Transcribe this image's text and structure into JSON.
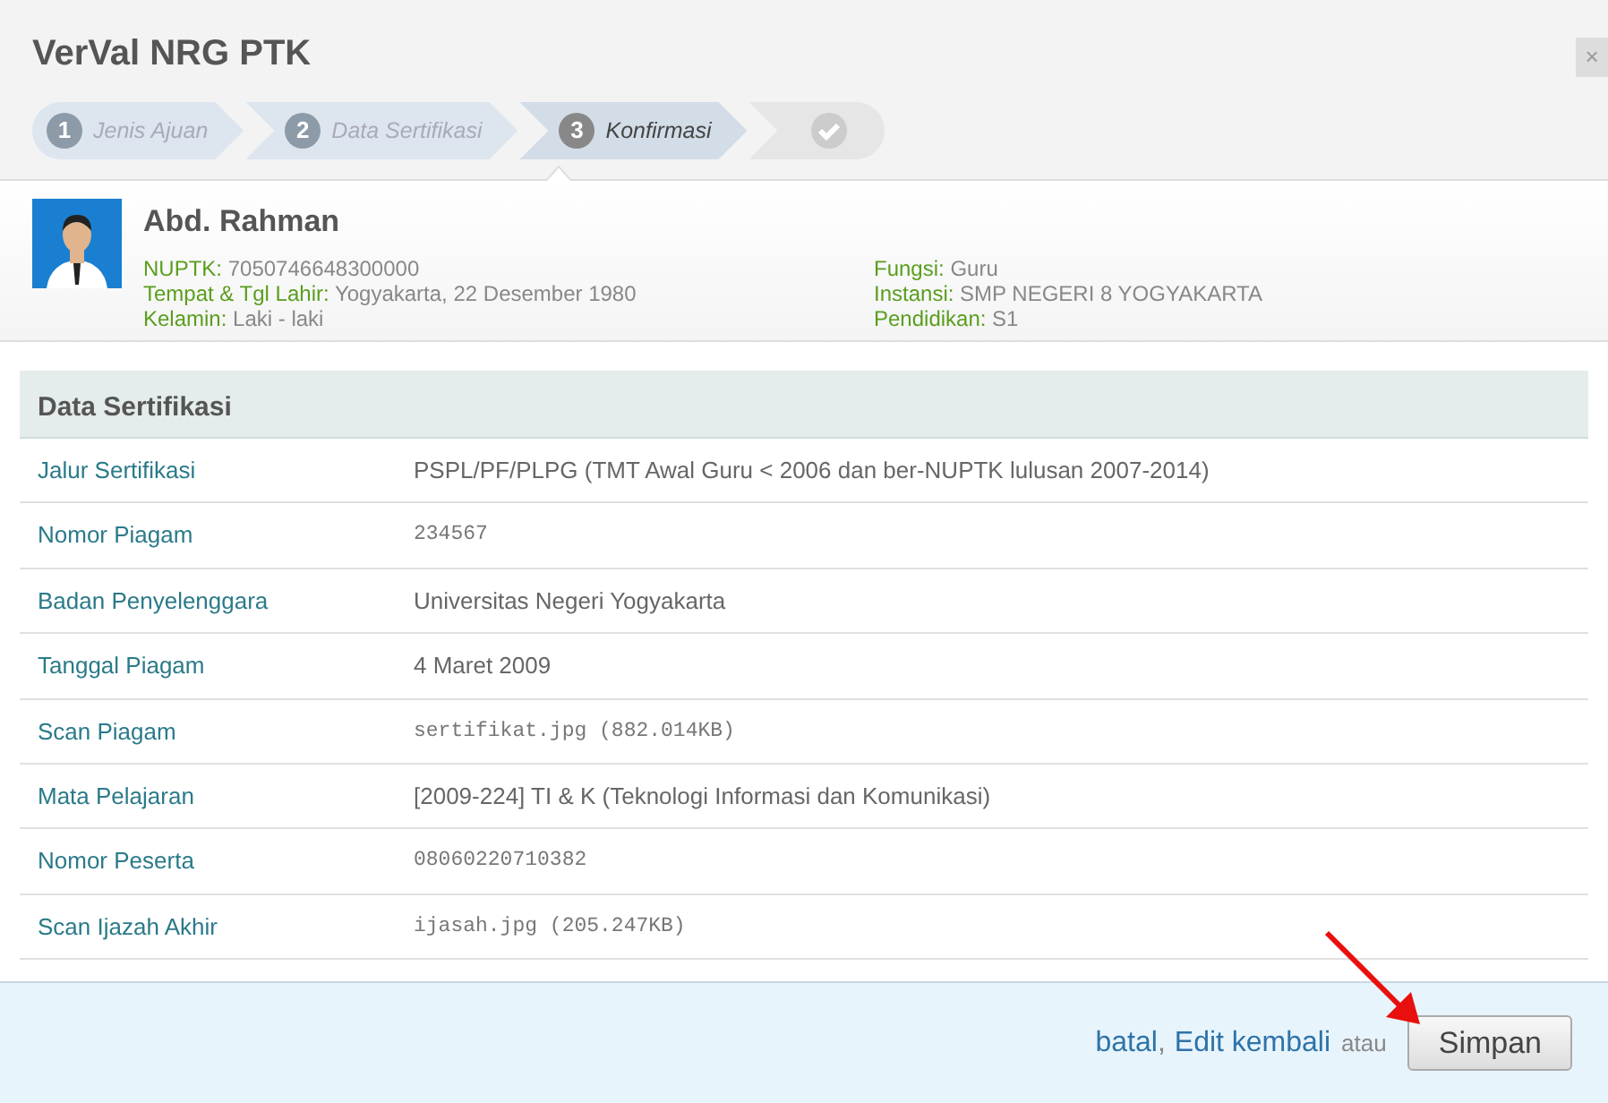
{
  "window": {
    "title": "VerVal NRG PTK",
    "close": "×"
  },
  "steps": [
    {
      "kind": "numbered",
      "number": "1",
      "label": "Jenis Ajuan",
      "selected": false
    },
    {
      "kind": "numbered",
      "number": "2",
      "label": "Data Sertifikasi",
      "selected": false
    },
    {
      "kind": "numbered",
      "number": "3",
      "label": "Konfirmasi",
      "selected": true
    },
    {
      "kind": "final",
      "selected": false
    }
  ],
  "profile": {
    "name": "Abd. Rahman",
    "left": [
      {
        "label": "NUPTK:",
        "value": "7050746648300000"
      },
      {
        "label": "Tempat & Tgl Lahir:",
        "value": "Yogyakarta, 22 Desember 1980"
      },
      {
        "label": "Kelamin:",
        "value": "Laki - laki"
      }
    ],
    "right": [
      {
        "label": "Fungsi:",
        "value": "Guru"
      },
      {
        "label": "Instansi:",
        "value": "SMP NEGERI 8 YOGYAKARTA"
      },
      {
        "label": "Pendidikan:",
        "value": "S1"
      }
    ]
  },
  "table": {
    "title": "Data Sertifikasi",
    "rows": [
      {
        "label": "Jalur Sertifikasi",
        "value": "PSPL/PF/PLPG (TMT Awal Guru < 2006 dan ber-NUPTK lulusan 2007-2014)",
        "kind": "text"
      },
      {
        "label": "Nomor Piagam",
        "value": "234567",
        "kind": "code"
      },
      {
        "label": "Badan Penyelenggara",
        "value": "Universitas Negeri Yogyakarta",
        "kind": "text"
      },
      {
        "label": "Tanggal Piagam",
        "value": "4 Maret 2009",
        "kind": "text"
      },
      {
        "label": "Scan Piagam",
        "value": "sertifikat.jpg (882.014KB)",
        "kind": "code"
      },
      {
        "label": "Mata Pelajaran",
        "value": "[2009-224] TI & K (Teknologi Informasi dan Komunikasi)",
        "kind": "text"
      },
      {
        "label": "Nomor Peserta",
        "value": "08060220710382",
        "kind": "code"
      },
      {
        "label": "Scan Ijazah Akhir",
        "value": "ijasah.jpg (205.247KB)",
        "kind": "code"
      }
    ]
  },
  "footer": {
    "cancel_link": "batal",
    "separator": ",",
    "edit_link": "Edit kembali",
    "or_text": "atau",
    "save_button": "Simpan"
  }
}
